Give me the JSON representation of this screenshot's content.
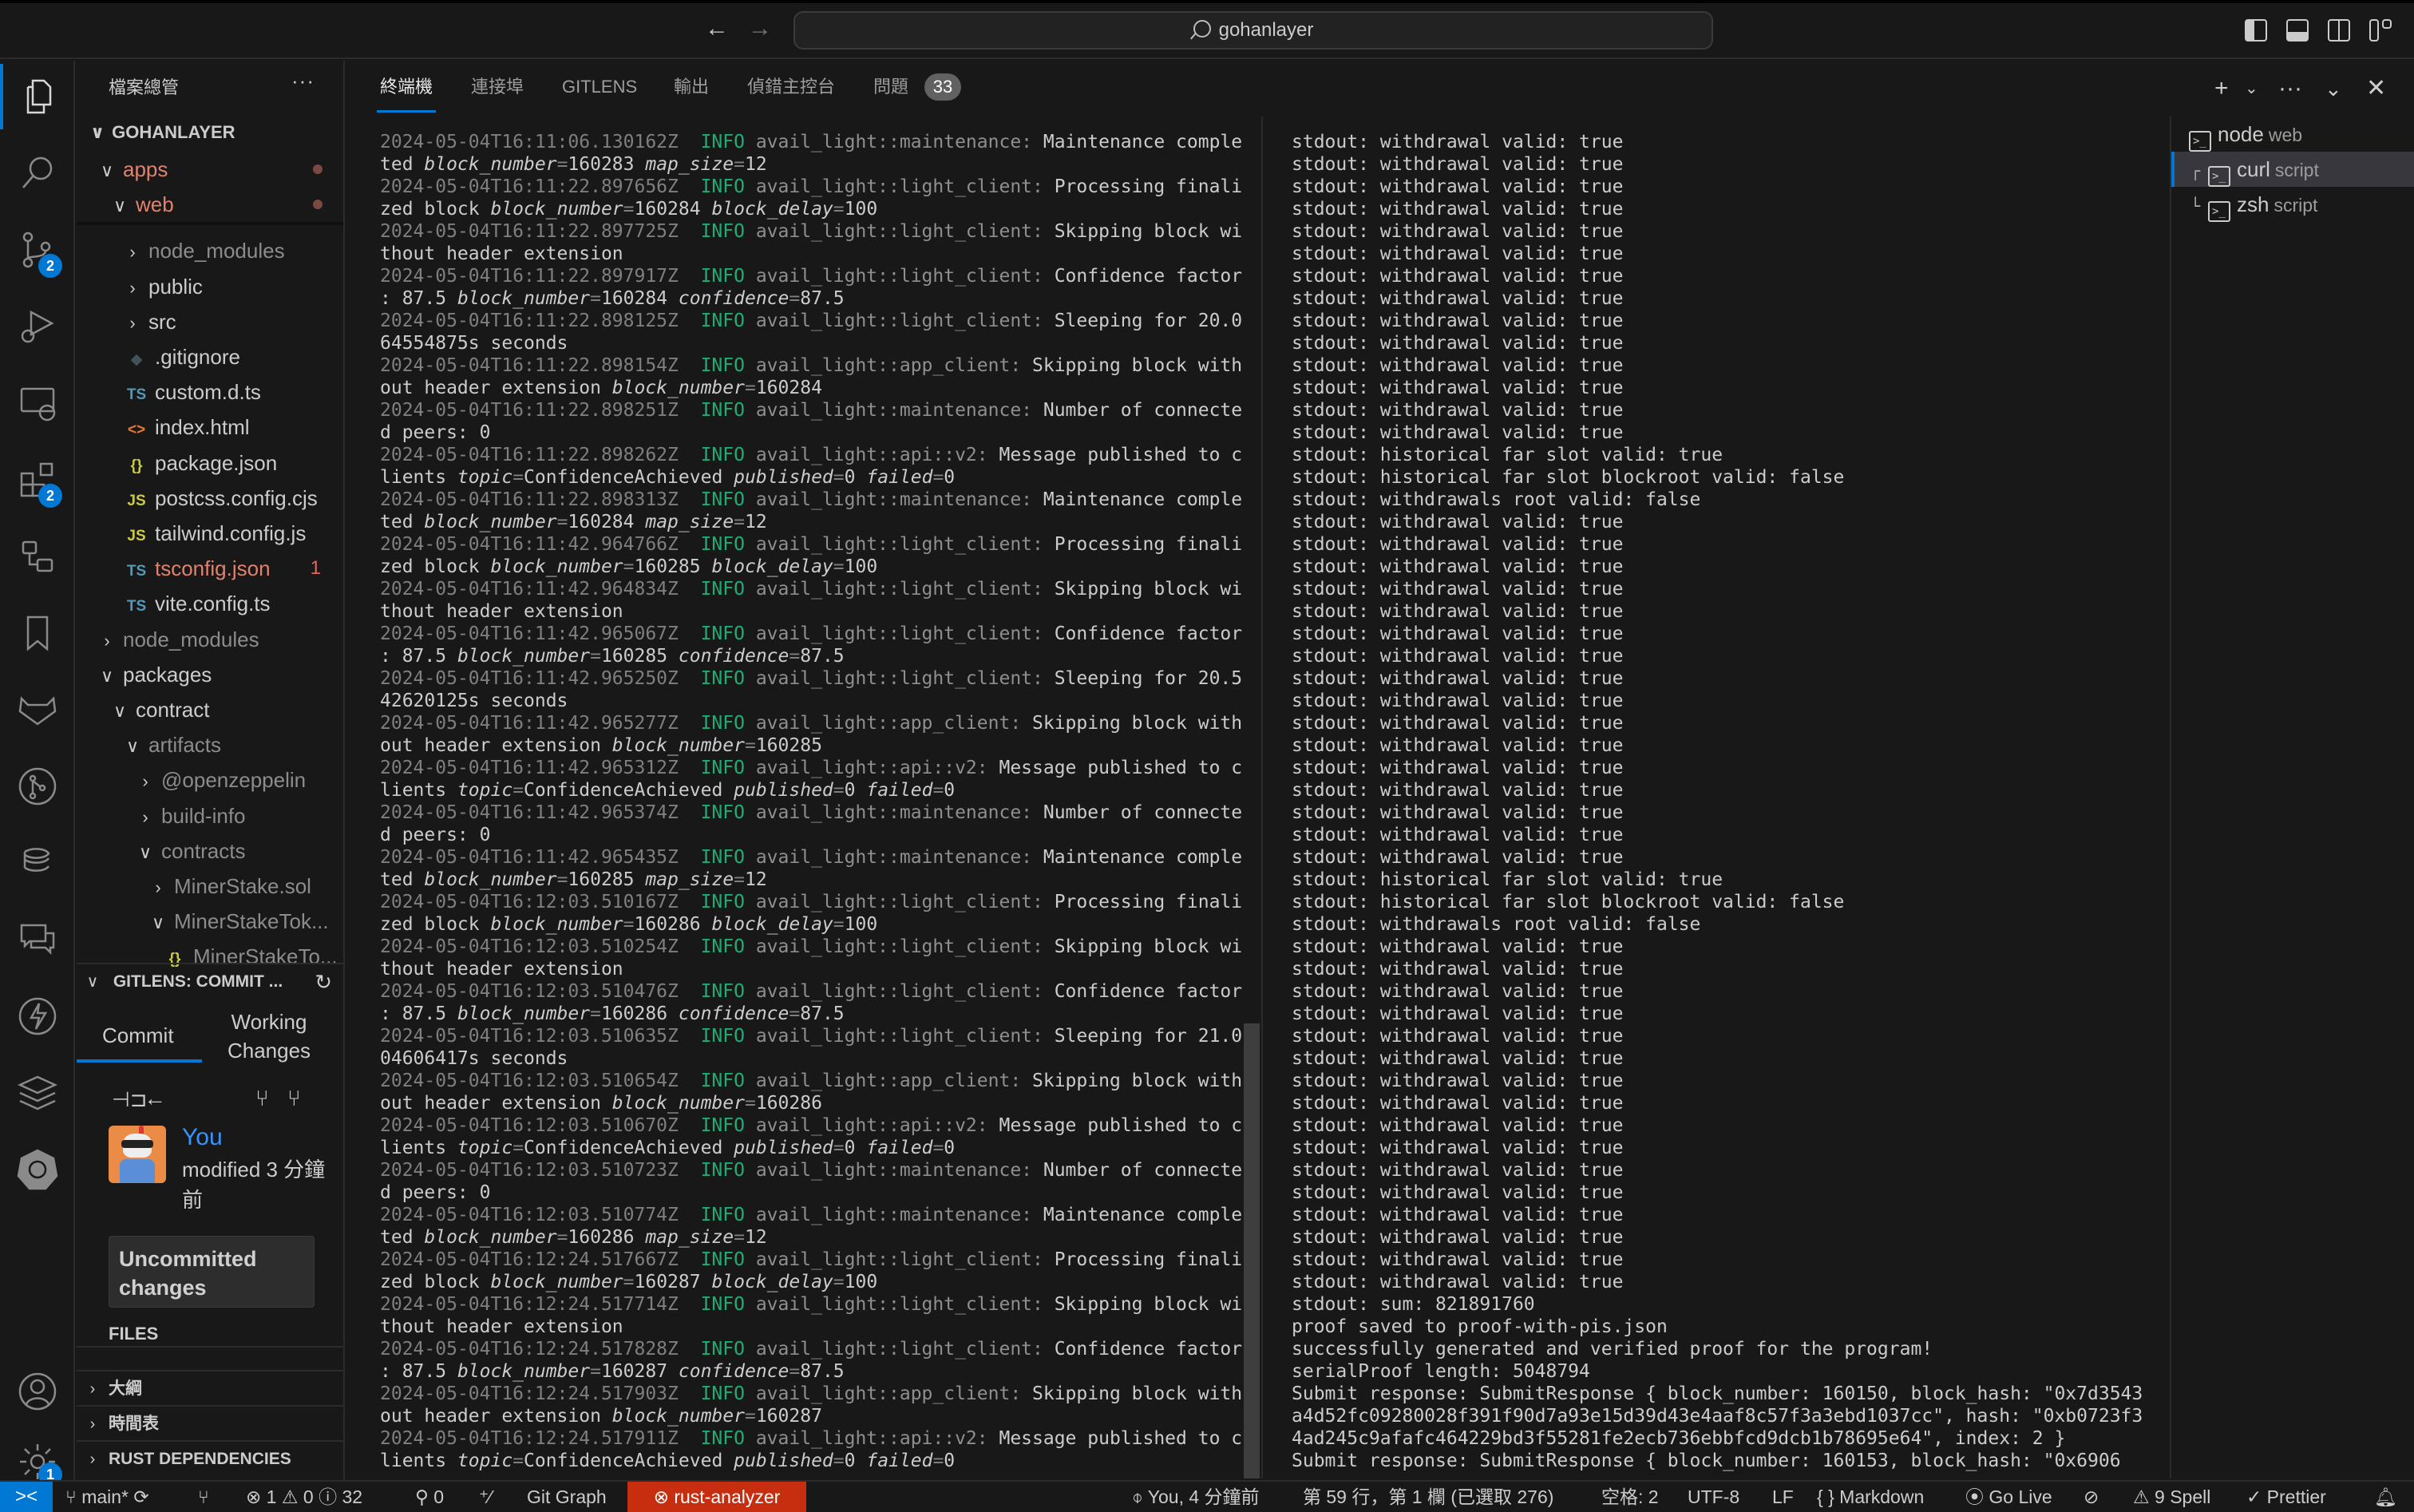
{
  "titlebar": {
    "search_text": "gohanlayer",
    "back_icon": "arrow-left-icon",
    "forward_icon": "arrow-right-icon"
  },
  "activity_bar": {
    "items": [
      {
        "name": "explorer",
        "icon": "files-icon",
        "active": true
      },
      {
        "name": "search",
        "icon": "search-icon"
      },
      {
        "name": "source-control",
        "icon": "source-control-icon",
        "badge": "2"
      },
      {
        "name": "run-debug",
        "icon": "debug-icon"
      },
      {
        "name": "remote-explorer",
        "icon": "remote-explorer-icon"
      },
      {
        "name": "extensions",
        "icon": "extensions-icon",
        "badge": "2"
      },
      {
        "name": "containers",
        "icon": "containers-icon"
      },
      {
        "name": "bookmarks",
        "icon": "bookmark-icon"
      },
      {
        "name": "gitlab",
        "icon": "gitlab-icon"
      },
      {
        "name": "git-graph",
        "icon": "git-graph-icon"
      },
      {
        "name": "database",
        "icon": "database-icon"
      },
      {
        "name": "comments",
        "icon": "comments-icon"
      },
      {
        "name": "thunder",
        "icon": "lightning-icon"
      },
      {
        "name": "stack",
        "icon": "layers-icon"
      },
      {
        "name": "kubernetes",
        "icon": "kubernetes-icon"
      }
    ],
    "bottom": [
      {
        "name": "accounts",
        "icon": "account-icon"
      },
      {
        "name": "manage",
        "icon": "gear-icon",
        "badge": "1"
      }
    ]
  },
  "sidebar": {
    "title": "檔案總管",
    "more": "···",
    "root": "GOHANLAYER",
    "tree": [
      {
        "label": "apps",
        "chev": "∨",
        "indent": 1,
        "style": "mod",
        "dot": true
      },
      {
        "label": "web",
        "chev": "∨",
        "indent": 2,
        "style": "mod",
        "dot": true
      },
      {
        "label": "node_modules",
        "chev": "›",
        "indent": 3,
        "style": "dim"
      },
      {
        "label": "public",
        "chev": "›",
        "indent": 3,
        "style": "norm"
      },
      {
        "label": "src",
        "chev": "›",
        "indent": 3,
        "style": "norm"
      },
      {
        "label": ".gitignore",
        "icon": "◆",
        "iconColor": "#41535b",
        "indent": 3,
        "style": "norm"
      },
      {
        "label": "custom.d.ts",
        "icon": "TS",
        "iconColor": "#519aba",
        "indent": 3,
        "style": "norm"
      },
      {
        "label": "index.html",
        "icon": "<>",
        "iconColor": "#e37933",
        "indent": 3,
        "style": "norm"
      },
      {
        "label": "package.json",
        "icon": "{}",
        "iconColor": "#cbcb41",
        "indent": 3,
        "style": "norm"
      },
      {
        "label": "postcss.config.cjs",
        "icon": "JS",
        "iconColor": "#cbcb41",
        "indent": 3,
        "style": "norm"
      },
      {
        "label": "tailwind.config.js",
        "icon": "JS",
        "iconColor": "#cbcb41",
        "indent": 3,
        "style": "norm"
      },
      {
        "label": "tsconfig.json",
        "icon": "TS",
        "iconColor": "#519aba",
        "indent": 3,
        "style": "mod",
        "count": "1"
      },
      {
        "label": "vite.config.ts",
        "icon": "TS",
        "iconColor": "#519aba",
        "indent": 3,
        "style": "norm"
      },
      {
        "label": "node_modules",
        "chev": "›",
        "indent": 1,
        "style": "dim"
      },
      {
        "label": "packages",
        "chev": "∨",
        "indent": 1,
        "style": "norm"
      },
      {
        "label": "contract",
        "chev": "∨",
        "indent": 2,
        "style": "norm"
      },
      {
        "label": "artifacts",
        "chev": "∨",
        "indent": 3,
        "style": "dim"
      },
      {
        "label": "@openzeppelin",
        "chev": "›",
        "indent": 4,
        "style": "dim"
      },
      {
        "label": "build-info",
        "chev": "›",
        "indent": 4,
        "style": "dim"
      },
      {
        "label": "contracts",
        "chev": "∨",
        "indent": 4,
        "style": "dim"
      },
      {
        "label": "MinerStake.sol",
        "chev": "›",
        "indent": 5,
        "style": "dim"
      },
      {
        "label": "MinerStakeTok...",
        "chev": "∨",
        "indent": 5,
        "style": "dim"
      },
      {
        "label": "MinerStakeTo...",
        "icon": "{}",
        "iconColor": "#cbcb41",
        "indent": 6,
        "style": "dim"
      }
    ],
    "gitlens": {
      "header": "GITLENS: COMMIT ...",
      "tabs": [
        "Commit",
        "Working Changes"
      ],
      "author": "You",
      "modified": "modified 3 分鐘前",
      "uncommitted": "Uncommitted changes",
      "files_label": "FILES"
    },
    "sections": [
      "大綱",
      "時間表",
      "RUST DEPENDENCIES"
    ]
  },
  "panel": {
    "tabs": [
      {
        "label": "終端機",
        "active": true
      },
      {
        "label": "連接埠"
      },
      {
        "label": "GITLENS"
      },
      {
        "label": "輸出"
      },
      {
        "label": "偵錯主控台"
      },
      {
        "label": "問題",
        "badge": "33"
      }
    ],
    "actions": [
      "new-terminal",
      "dropdown",
      "more",
      "maximize",
      "close"
    ]
  },
  "terminal_left": [
    {
      "ts": "2024-05-04T16:11:06.130162Z",
      "target": "avail_light::maintenance:",
      "msg": "Maintenance completed",
      "fields": [
        [
          "block_number",
          "160283"
        ],
        [
          "map_size",
          "12"
        ]
      ]
    },
    {
      "ts": "2024-05-04T16:11:22.897656Z",
      "target": "avail_light::light_client:",
      "msg": "Processing finalized block",
      "fields": [
        [
          "block_number",
          "160284"
        ],
        [
          "block_delay",
          "100"
        ]
      ]
    },
    {
      "ts": "2024-05-04T16:11:22.897725Z",
      "target": "avail_light::light_client:",
      "msg": "Skipping block without header extension",
      "fields": []
    },
    {
      "ts": "2024-05-04T16:11:22.897917Z",
      "target": "avail_light::light_client:",
      "msg": "Confidence factor: 87.5",
      "fields": [
        [
          "block_number",
          "160284"
        ],
        [
          "confidence",
          "87.5"
        ]
      ]
    },
    {
      "ts": "2024-05-04T16:11:22.898125Z",
      "target": "avail_light::light_client:",
      "msg": "Sleeping for 20.064554875s seconds",
      "fields": []
    },
    {
      "ts": "2024-05-04T16:11:22.898154Z",
      "target": "avail_light::app_client:",
      "msg": "Skipping block without header extension",
      "fields": [
        [
          "block_number",
          "160284"
        ]
      ]
    },
    {
      "ts": "2024-05-04T16:11:22.898251Z",
      "target": "avail_light::maintenance:",
      "msg": "Number of connected peers: 0",
      "fields": []
    },
    {
      "ts": "2024-05-04T16:11:22.898262Z",
      "target": "avail_light::api::v2:",
      "msg": "Message published to clients",
      "fields": [
        [
          "topic",
          "ConfidenceAchieved"
        ],
        [
          "published",
          "0"
        ],
        [
          "failed",
          "0"
        ]
      ]
    },
    {
      "ts": "2024-05-04T16:11:22.898313Z",
      "target": "avail_light::maintenance:",
      "msg": "Maintenance completed",
      "fields": [
        [
          "block_number",
          "160284"
        ],
        [
          "map_size",
          "12"
        ]
      ]
    },
    {
      "ts": "2024-05-04T16:11:42.964766Z",
      "target": "avail_light::light_client:",
      "msg": "Processing finalized block",
      "fields": [
        [
          "block_number",
          "160285"
        ],
        [
          "block_delay",
          "100"
        ]
      ]
    },
    {
      "ts": "2024-05-04T16:11:42.964834Z",
      "target": "avail_light::light_client:",
      "msg": "Skipping block without header extension",
      "fields": []
    },
    {
      "ts": "2024-05-04T16:11:42.965067Z",
      "target": "avail_light::light_client:",
      "msg": "Confidence factor: 87.5",
      "fields": [
        [
          "block_number",
          "160285"
        ],
        [
          "confidence",
          "87.5"
        ]
      ]
    },
    {
      "ts": "2024-05-04T16:11:42.965250Z",
      "target": "avail_light::light_client:",
      "msg": "Sleeping for 20.542620125s seconds",
      "fields": []
    },
    {
      "ts": "2024-05-04T16:11:42.965277Z",
      "target": "avail_light::app_client:",
      "msg": "Skipping block without header extension",
      "fields": [
        [
          "block_number",
          "160285"
        ]
      ]
    },
    {
      "ts": "2024-05-04T16:11:42.965312Z",
      "target": "avail_light::api::v2:",
      "msg": "Message published to clients",
      "fields": [
        [
          "topic",
          "ConfidenceAchieved"
        ],
        [
          "published",
          "0"
        ],
        [
          "failed",
          "0"
        ]
      ]
    },
    {
      "ts": "2024-05-04T16:11:42.965374Z",
      "target": "avail_light::maintenance:",
      "msg": "Number of connected peers: 0",
      "fields": []
    },
    {
      "ts": "2024-05-04T16:11:42.965435Z",
      "target": "avail_light::maintenance:",
      "msg": "Maintenance completed",
      "fields": [
        [
          "block_number",
          "160285"
        ],
        [
          "map_size",
          "12"
        ]
      ]
    },
    {
      "ts": "2024-05-04T16:12:03.510167Z",
      "target": "avail_light::light_client:",
      "msg": "Processing finalized block",
      "fields": [
        [
          "block_number",
          "160286"
        ],
        [
          "block_delay",
          "100"
        ]
      ]
    },
    {
      "ts": "2024-05-04T16:12:03.510254Z",
      "target": "avail_light::light_client:",
      "msg": "Skipping block without header extension",
      "fields": []
    },
    {
      "ts": "2024-05-04T16:12:03.510476Z",
      "target": "avail_light::light_client:",
      "msg": "Confidence factor: 87.5",
      "fields": [
        [
          "block_number",
          "160286"
        ],
        [
          "confidence",
          "87.5"
        ]
      ]
    },
    {
      "ts": "2024-05-04T16:12:03.510635Z",
      "target": "avail_light::light_client:",
      "msg": "Sleeping for 21.004606417s seconds",
      "fields": []
    },
    {
      "ts": "2024-05-04T16:12:03.510654Z",
      "target": "avail_light::app_client:",
      "msg": "Skipping block without header extension",
      "fields": [
        [
          "block_number",
          "160286"
        ]
      ]
    },
    {
      "ts": "2024-05-04T16:12:03.510670Z",
      "target": "avail_light::api::v2:",
      "msg": "Message published to clients",
      "fields": [
        [
          "topic",
          "ConfidenceAchieved"
        ],
        [
          "published",
          "0"
        ],
        [
          "failed",
          "0"
        ]
      ]
    },
    {
      "ts": "2024-05-04T16:12:03.510723Z",
      "target": "avail_light::maintenance:",
      "msg": "Number of connected peers: 0",
      "fields": []
    },
    {
      "ts": "2024-05-04T16:12:03.510774Z",
      "target": "avail_light::maintenance:",
      "msg": "Maintenance completed",
      "fields": [
        [
          "block_number",
          "160286"
        ],
        [
          "map_size",
          "12"
        ]
      ]
    },
    {
      "ts": "2024-05-04T16:12:24.517667Z",
      "target": "avail_light::light_client:",
      "msg": "Processing finalized block",
      "fields": [
        [
          "block_number",
          "160287"
        ],
        [
          "block_delay",
          "100"
        ]
      ]
    },
    {
      "ts": "2024-05-04T16:12:24.517714Z",
      "target": "avail_light::light_client:",
      "msg": "Skipping block without header extension",
      "fields": []
    },
    {
      "ts": "2024-05-04T16:12:24.517828Z",
      "target": "avail_light::light_client:",
      "msg": "Confidence factor: 87.5",
      "fields": [
        [
          "block_number",
          "160287"
        ],
        [
          "confidence",
          "87.5"
        ]
      ]
    },
    {
      "ts": "2024-05-04T16:12:24.517903Z",
      "target": "avail_light::app_client:",
      "msg": "Skipping block without header extension",
      "fields": [
        [
          "block_number",
          "160287"
        ]
      ]
    },
    {
      "ts": "2024-05-04T16:12:24.517911Z",
      "target": "avail_light::api::v2:",
      "msg": "Message published to clients",
      "fields": [
        [
          "topic",
          "ConfidenceAchieved"
        ],
        [
          "published",
          "0"
        ],
        [
          "failed",
          "0"
        ]
      ]
    }
  ],
  "terminal_left_level": "INFO",
  "terminal_right": {
    "groups": [
      {
        "line": "stdout: withdrawal valid: true",
        "repeat": 14
      },
      {
        "line": "stdout: historical far slot valid: true",
        "repeat": 1
      },
      {
        "line": "stdout: historical far slot blockroot valid: false",
        "repeat": 1
      },
      {
        "line": "stdout: withdrawals root valid: false",
        "repeat": 1
      },
      {
        "line": "stdout: withdrawal valid: true",
        "repeat": 16
      },
      {
        "line": "stdout: historical far slot valid: true",
        "repeat": 1
      },
      {
        "line": "stdout: historical far slot blockroot valid: false",
        "repeat": 1
      },
      {
        "line": "stdout: withdrawals root valid: false",
        "repeat": 1
      },
      {
        "line": "stdout: withdrawal valid: true",
        "repeat": 16
      },
      {
        "line": "stdout: sum: 821891760",
        "repeat": 1
      },
      {
        "line": "proof saved to proof-with-pis.json",
        "repeat": 1
      },
      {
        "line": "successfully generated and verified proof for the program!",
        "repeat": 1
      },
      {
        "line": "serialProof length: 5048794",
        "repeat": 1
      },
      {
        "line": "Submit response: SubmitResponse { block_number: 160150, block_hash: \"0x7d3543a4d52fc09280028f391f90d7a93e15d39d43e4aaf8c57f3a3ebd1037cc\", hash: \"0xb0723f34ad245c9afafc464229bd3f55281fe2ecb736ebbfcd9dcb1b78695e64\", index: 2 }",
        "repeat": 1
      },
      {
        "line": "Submit response: SubmitResponse { block_number: 160153, block_hash: \"0x6906",
        "repeat": 1
      }
    ]
  },
  "terminal_list": [
    {
      "name": "node",
      "sub": "web",
      "tree": ""
    },
    {
      "name": "curl",
      "sub": "script",
      "tree": "┌",
      "selected": true
    },
    {
      "name": "zsh",
      "sub": "script",
      "tree": "└"
    }
  ],
  "statusbar": {
    "remote": "><",
    "branch": "main*",
    "errors": "1",
    "warnings": "0",
    "infos": "32",
    "ports": "0",
    "git_graph": "Git Graph",
    "rust_analyzer": "rust-analyzer",
    "blame": "You, 4 分鐘前",
    "cursor": "第 59 行，第 1 欄 (已選取 276)",
    "spaces": "空格: 2",
    "encoding": "UTF-8",
    "eol": "LF",
    "language": "Markdown",
    "go_live": "Go Live",
    "spell": "9 Spell",
    "prettier": "Prettier"
  },
  "colors": {
    "accent": "#0078d4",
    "error_bg": "#c72e0f",
    "info_level": "#23d18b",
    "modified": "#e0826d"
  }
}
